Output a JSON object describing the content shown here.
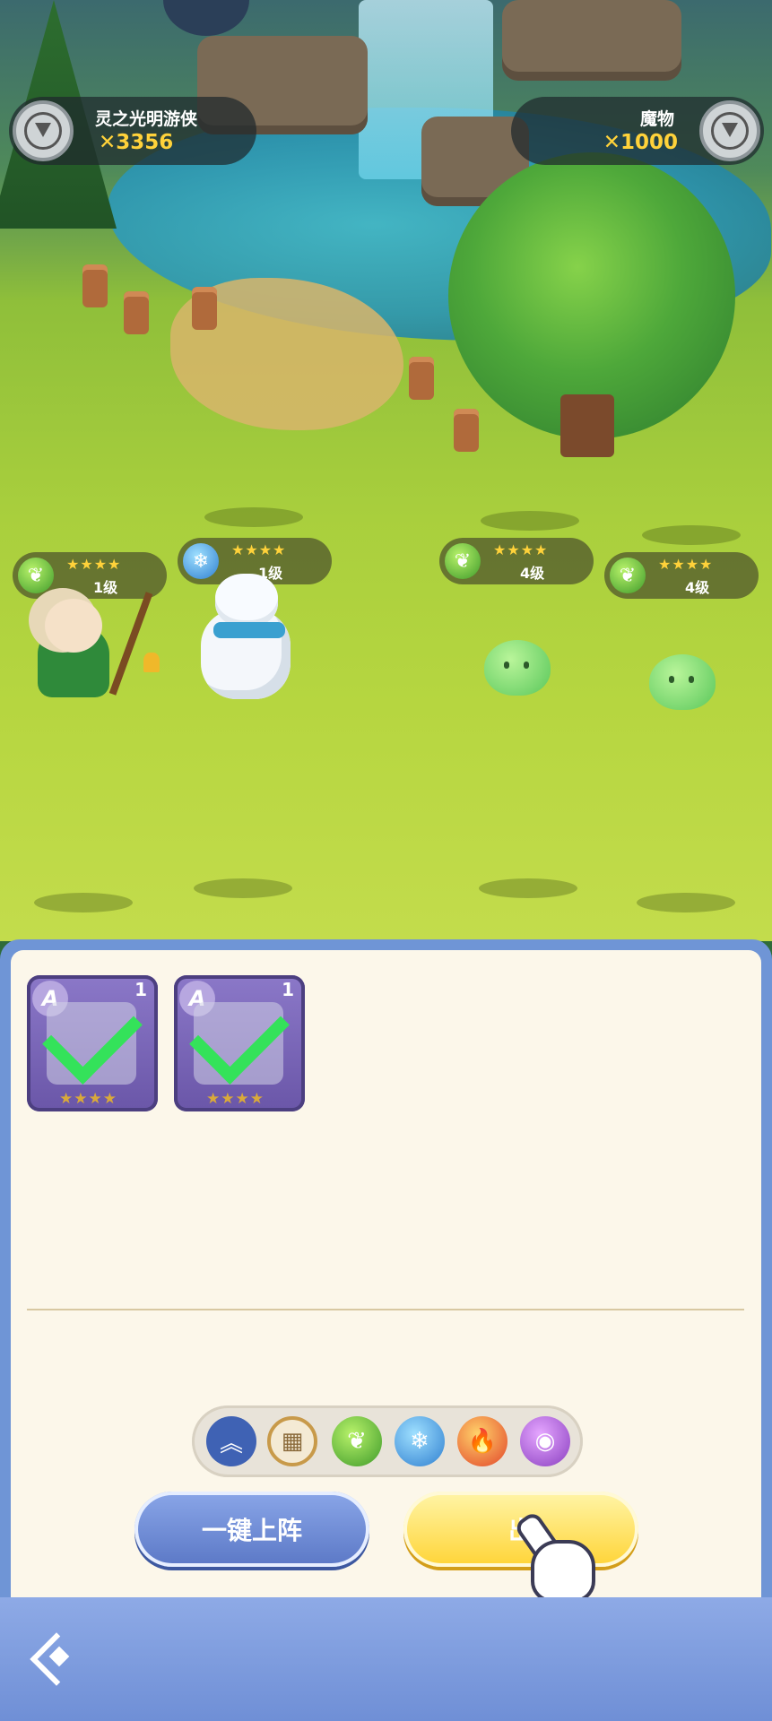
{
  "players": {
    "left": {
      "name": "灵之光明游侠",
      "power": "3356",
      "power_icon": "crossed-swords"
    },
    "right": {
      "name": "魔物",
      "power": "1000",
      "power_icon": "crossed-swords"
    }
  },
  "units": [
    {
      "side": "ally",
      "element": "grass",
      "element_icon": "❦",
      "stars": "★★★★",
      "level": "1级",
      "rating": 4
    },
    {
      "side": "ally",
      "element": "ice",
      "element_icon": "❄",
      "stars": "★★★★",
      "level": "1级",
      "rating": 4
    },
    {
      "side": "enemy",
      "element": "grass",
      "element_icon": "❦",
      "stars": "★★★★",
      "level": "4级",
      "rating": 4
    },
    {
      "side": "enemy",
      "element": "grass",
      "element_icon": "❦",
      "stars": "★★★★",
      "level": "4级",
      "rating": 4
    }
  ],
  "roster": [
    {
      "rank": "A",
      "count": "1",
      "stars": "★★★★",
      "selected": true,
      "portrait": "polar-bear"
    },
    {
      "rank": "A",
      "count": "1",
      "stars": "★★★★",
      "selected": true,
      "portrait": "shepherd-girl"
    }
  ],
  "filters": [
    {
      "id": "up",
      "icon": "double-chevron-up",
      "glyph": "︽"
    },
    {
      "id": "all",
      "icon": "grid",
      "glyph": "▦",
      "active": true
    },
    {
      "id": "grass",
      "icon": "leaf",
      "glyph": "❦"
    },
    {
      "id": "ice",
      "icon": "snowflake",
      "glyph": "❄"
    },
    {
      "id": "fire",
      "icon": "flame",
      "glyph": "🔥"
    },
    {
      "id": "dark",
      "icon": "eye",
      "glyph": "◉"
    }
  ],
  "buttons": {
    "auto_deploy": "一键上阵",
    "deploy": "出"
  },
  "colors": {
    "gold": "#ffd23a",
    "panel_border": "#6f95d6",
    "check": "#34e25a"
  }
}
